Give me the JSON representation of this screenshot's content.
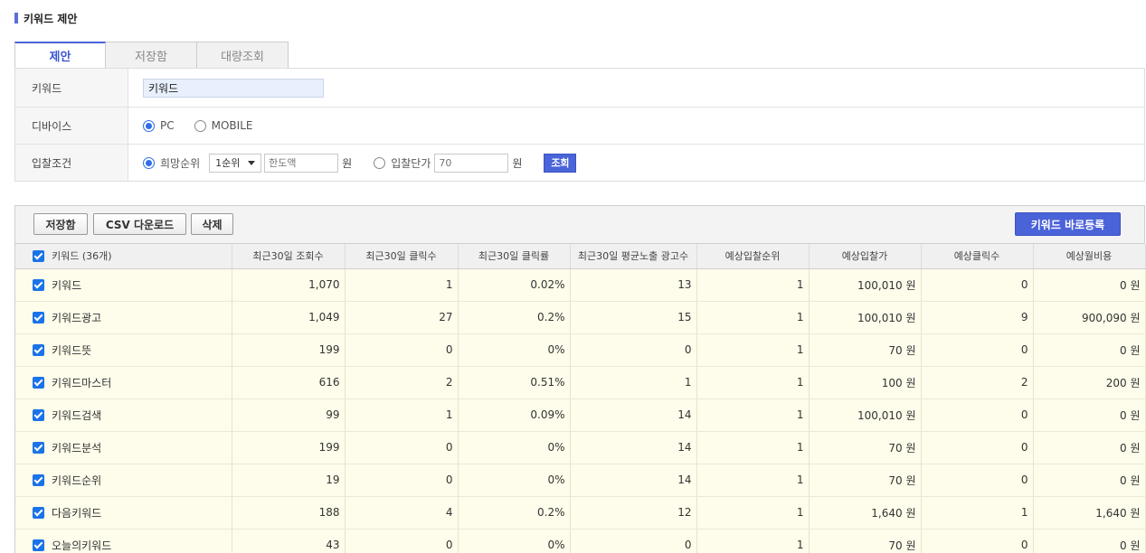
{
  "page_title": "키워드 제안",
  "tabs": [
    {
      "label": "제안",
      "active": true
    },
    {
      "label": "저장함",
      "active": false
    },
    {
      "label": "대량조회",
      "active": false
    }
  ],
  "form": {
    "keyword": {
      "label": "키워드",
      "value": "키워드"
    },
    "device": {
      "label": "디바이스",
      "options": [
        "PC",
        "MOBILE"
      ],
      "selected": "PC"
    },
    "bid": {
      "label": "입찰조건",
      "option1": "희망순위",
      "rank_select": "1순위",
      "limit_placeholder": "한도액",
      "unit": "원",
      "option2": "입찰단가",
      "price_placeholder": "70",
      "query_button": "조회",
      "selected": "희망순위"
    }
  },
  "toolbar": {
    "save": "저장함",
    "csv": "CSV 다운로드",
    "delete": "삭제",
    "register": "키워드 바로등록"
  },
  "columns": [
    "키워드 (36개)",
    "최근30일 조회수",
    "최근30일 클릭수",
    "최근30일 클릭률",
    "최근30일 평균노출 광고수",
    "예상입찰순위",
    "예상입찰가",
    "예상클릭수",
    "예상월비용"
  ],
  "rows": [
    {
      "keyword": "키워드",
      "views": "1,070",
      "clicks": "1",
      "ctr": "0.02%",
      "ads": "13",
      "rank": "1",
      "bid": "100,010 원",
      "est_clicks": "0",
      "cost": "0 원"
    },
    {
      "keyword": "키워드광고",
      "views": "1,049",
      "clicks": "27",
      "ctr": "0.2%",
      "ads": "15",
      "rank": "1",
      "bid": "100,010 원",
      "est_clicks": "9",
      "cost": "900,090 원"
    },
    {
      "keyword": "키워드뜻",
      "views": "199",
      "clicks": "0",
      "ctr": "0%",
      "ads": "0",
      "rank": "1",
      "bid": "70 원",
      "est_clicks": "0",
      "cost": "0 원"
    },
    {
      "keyword": "키워드마스터",
      "views": "616",
      "clicks": "2",
      "ctr": "0.51%",
      "ads": "1",
      "rank": "1",
      "bid": "100 원",
      "est_clicks": "2",
      "cost": "200 원"
    },
    {
      "keyword": "키워드검색",
      "views": "99",
      "clicks": "1",
      "ctr": "0.09%",
      "ads": "14",
      "rank": "1",
      "bid": "100,010 원",
      "est_clicks": "0",
      "cost": "0 원"
    },
    {
      "keyword": "키워드분석",
      "views": "199",
      "clicks": "0",
      "ctr": "0%",
      "ads": "14",
      "rank": "1",
      "bid": "70 원",
      "est_clicks": "0",
      "cost": "0 원"
    },
    {
      "keyword": "키워드순위",
      "views": "19",
      "clicks": "0",
      "ctr": "0%",
      "ads": "14",
      "rank": "1",
      "bid": "70 원",
      "est_clicks": "0",
      "cost": "0 원"
    },
    {
      "keyword": "다음키워드",
      "views": "188",
      "clicks": "4",
      "ctr": "0.2%",
      "ads": "12",
      "rank": "1",
      "bid": "1,640 원",
      "est_clicks": "1",
      "cost": "1,640 원"
    },
    {
      "keyword": "오늘의키워드",
      "views": "43",
      "clicks": "0",
      "ctr": "0%",
      "ads": "0",
      "rank": "1",
      "bid": "70 원",
      "est_clicks": "0",
      "cost": "0 원"
    }
  ]
}
